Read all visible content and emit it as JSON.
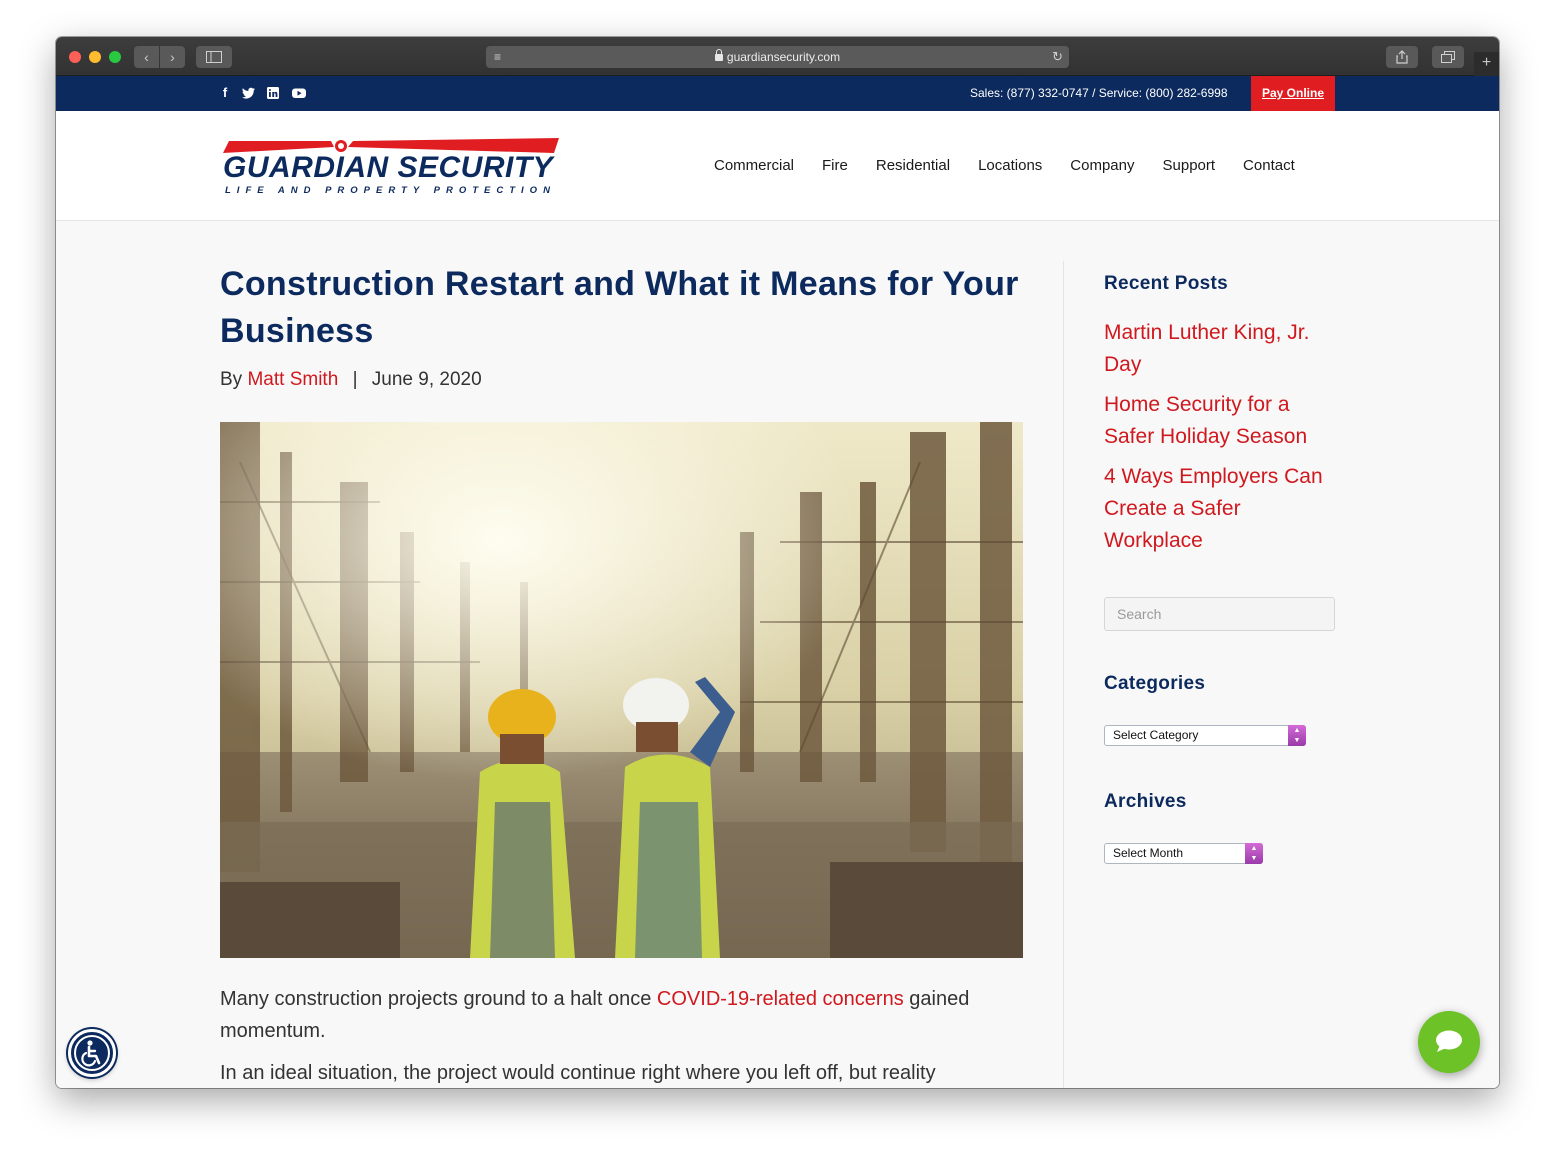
{
  "browser": {
    "url": "guardiansecurity.com",
    "icons": [
      "back-icon",
      "forward-icon",
      "sidebar-icon",
      "reader-icon",
      "lock-icon",
      "reload-icon",
      "share-icon",
      "tabs-icon",
      "new-tab-icon"
    ]
  },
  "topbar": {
    "social_icons": [
      "facebook-icon",
      "twitter-icon",
      "linkedin-icon",
      "youtube-icon"
    ],
    "phones": "Sales: (877) 332-0747 / Service: (800) 282-6998",
    "pay_label": "Pay Online"
  },
  "logo": {
    "name": "GUARDIAN SECURITY",
    "tagline": "LIFE AND PROPERTY PROTECTION"
  },
  "nav": [
    "Commercial",
    "Fire",
    "Residential",
    "Locations",
    "Company",
    "Support",
    "Contact"
  ],
  "article": {
    "title": "Construction Restart and What it Means for Your Business",
    "by": "By",
    "author": "Matt Smith",
    "sep": "|",
    "date": "June 9, 2020",
    "p1_before": "Many construction projects ground to a halt once ",
    "p1_link": "COVID-19-related concerns",
    "p1_after": " gained momentum.",
    "p2": "In an ideal situation, the project would continue right where you left off, but reality"
  },
  "sidebar": {
    "recent_title": "Recent Posts",
    "recent_posts": [
      "Martin Luther King, Jr. Day",
      "Home Security for a Safer Holiday Season",
      "4 Ways Employers Can Create a Safer Workplace"
    ],
    "search_placeholder": "Search",
    "categories_title": "Categories",
    "categories_selected": "Select Category",
    "archives_title": "Archives",
    "archives_selected": "Select Month"
  },
  "colors": {
    "navy": "#0c2a5e",
    "red": "#d0191f",
    "pay_red": "#e01e22",
    "chat_green": "#6cc226"
  },
  "widgets": [
    "accessibility-icon",
    "chat-icon"
  ]
}
